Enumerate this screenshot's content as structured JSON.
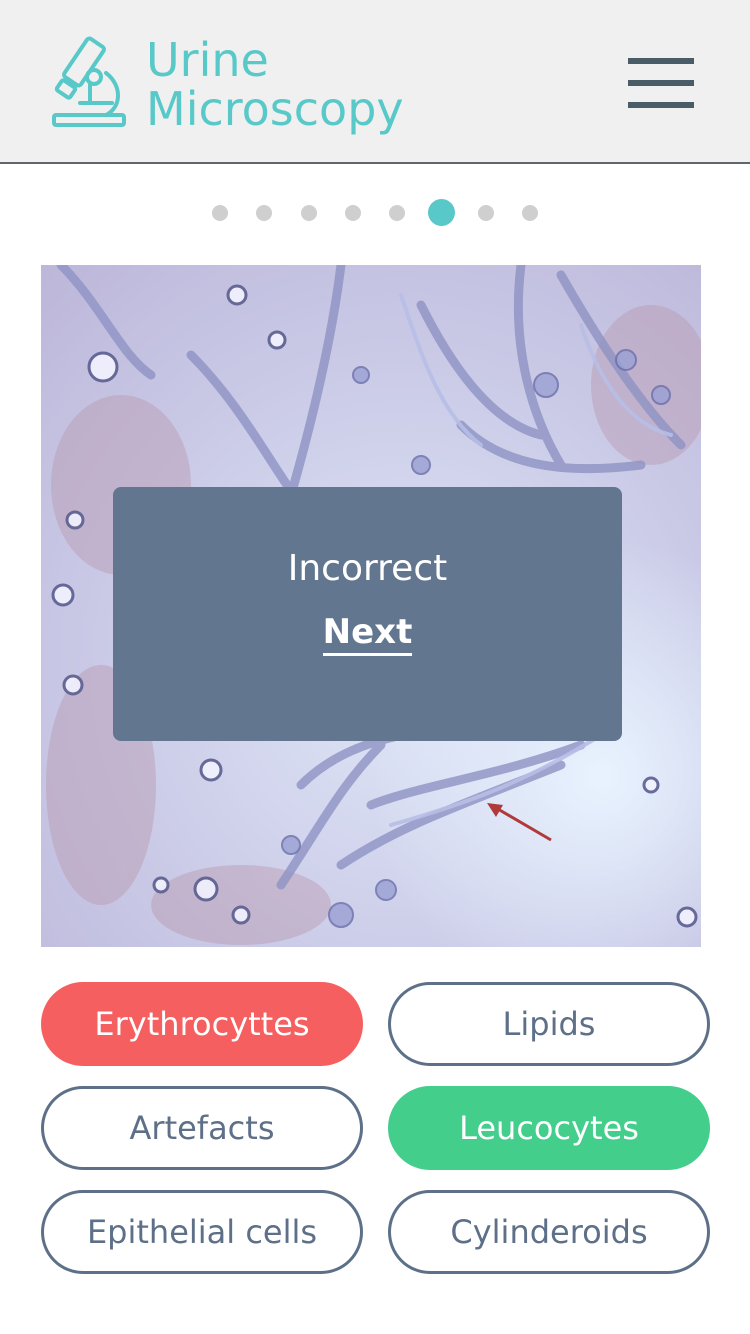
{
  "header": {
    "title_line1": "Urine",
    "title_line2": "Microscopy",
    "logo_icon": "microscope-icon",
    "menu_icon": "hamburger-menu-icon",
    "accent_color": "#58c9c8"
  },
  "pager": {
    "total": 8,
    "current": 6
  },
  "specimen": {
    "image": "urine-sediment-micrograph"
  },
  "feedback": {
    "message": "Incorrect",
    "next_label": "Next"
  },
  "answers": [
    {
      "label": "Erythrocyttes",
      "state": "wrong"
    },
    {
      "label": "Lipids",
      "state": "default"
    },
    {
      "label": "Artefacts",
      "state": "default"
    },
    {
      "label": "Leucocytes",
      "state": "correct"
    },
    {
      "label": "Epithelial cells",
      "state": "default"
    },
    {
      "label": "Cylinderoids",
      "state": "default"
    }
  ],
  "colors": {
    "wrong": "#f55f5f",
    "correct": "#43ce8c",
    "outline": "#5d7088",
    "overlay": "#627690"
  }
}
